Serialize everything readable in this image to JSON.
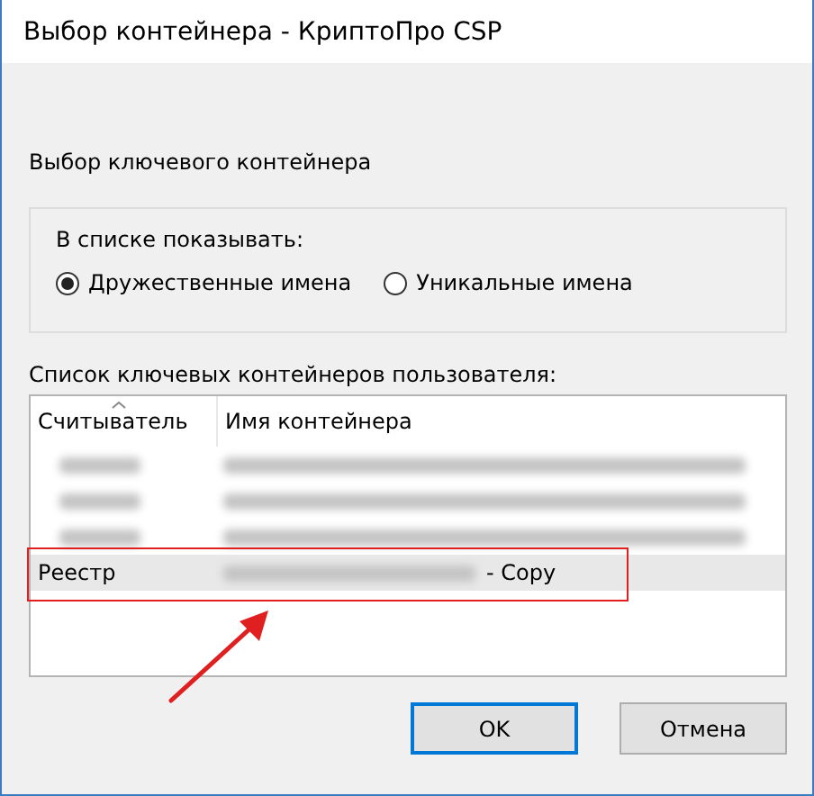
{
  "window": {
    "title": "Выбор контейнера - КриптоПро CSP"
  },
  "heading": "Выбор ключевого контейнера",
  "display_group": {
    "label": "В списке показывать:",
    "options": [
      {
        "label": "Дружественные имена",
        "selected": true
      },
      {
        "label": "Уникальные имена",
        "selected": false
      }
    ]
  },
  "list_label": "Список ключевых контейнеров пользователя:",
  "table": {
    "columns": [
      {
        "label": "Считыватель",
        "sorted": true
      },
      {
        "label": "Имя контейнера",
        "sorted": false
      }
    ],
    "rows": [
      {
        "kind": "blurred",
        "selected": false,
        "highlighted": false
      },
      {
        "kind": "blurred",
        "selected": false,
        "highlighted": false
      },
      {
        "kind": "blurred",
        "selected": false,
        "highlighted": false
      },
      {
        "kind": "partial",
        "reader": "Реестр",
        "name_suffix": "- Copy",
        "selected": true,
        "highlighted": true
      }
    ]
  },
  "buttons": [
    {
      "label": "OK",
      "default": true
    },
    {
      "label": "Отмена",
      "default": false
    }
  ]
}
